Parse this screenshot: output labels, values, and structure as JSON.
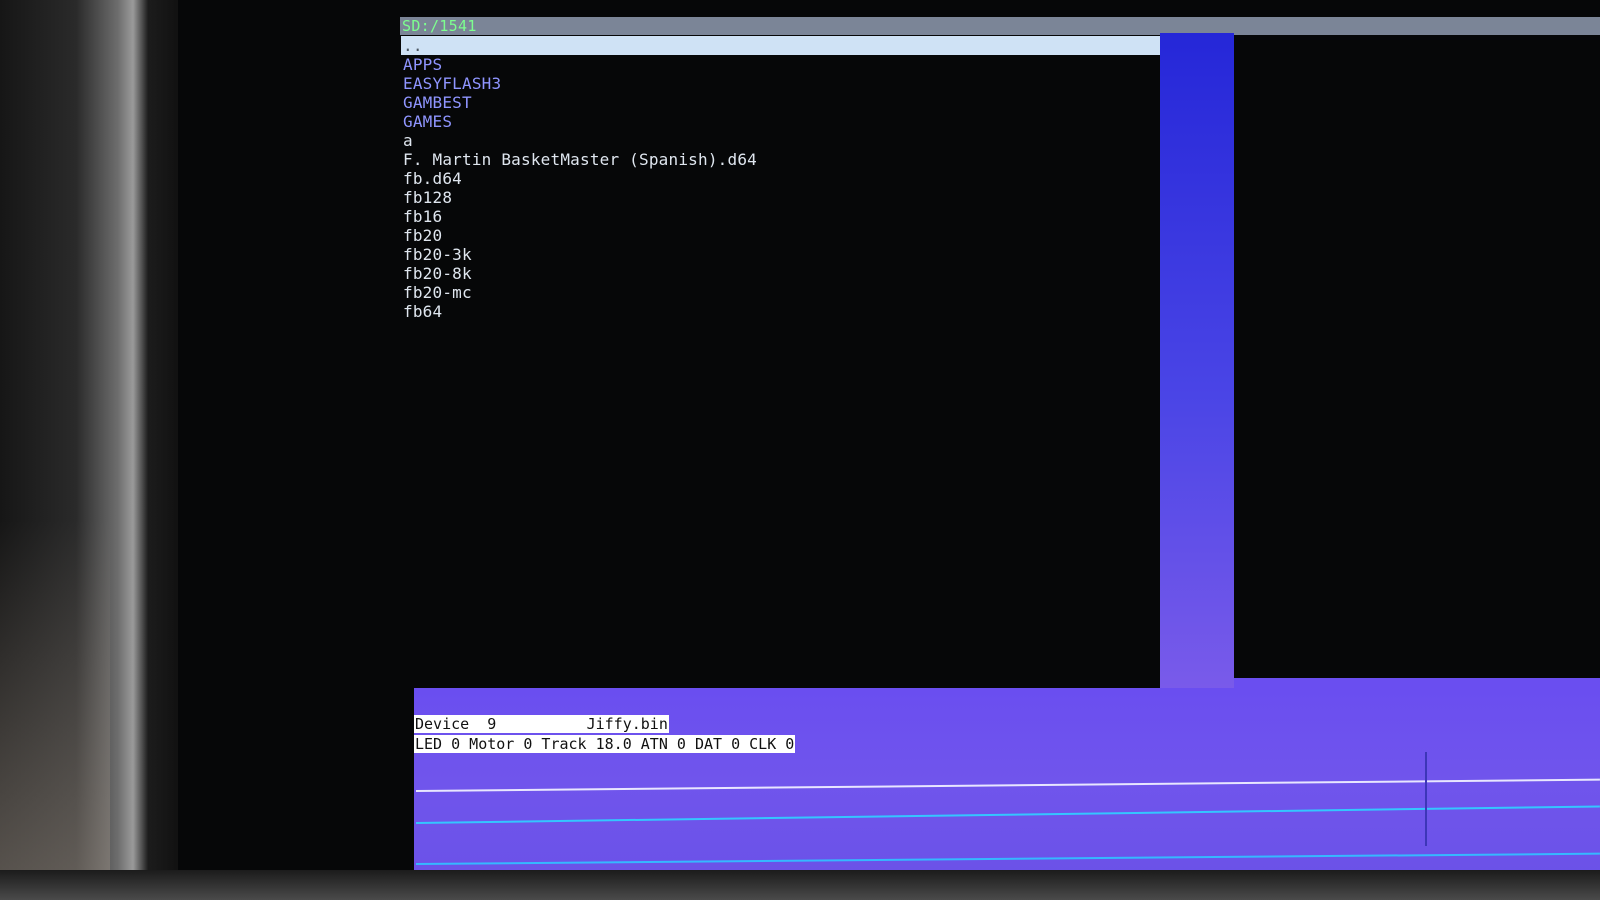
{
  "browser": {
    "path": "SD:/1541",
    "entries": [
      {
        "label": "..",
        "type": "parent",
        "selected": true
      },
      {
        "label": "APPS",
        "type": "dir"
      },
      {
        "label": "EASYFLASH3",
        "type": "dir"
      },
      {
        "label": "GAMBEST",
        "type": "dir"
      },
      {
        "label": "GAMES",
        "type": "dir"
      },
      {
        "label": "a",
        "type": "file"
      },
      {
        "label": "F. Martin BasketMaster (Spanish).d64",
        "type": "file"
      },
      {
        "label": "fb.d64",
        "type": "file"
      },
      {
        "label": "fb128",
        "type": "file"
      },
      {
        "label": "fb16",
        "type": "file"
      },
      {
        "label": "fb20",
        "type": "file"
      },
      {
        "label": "fb20-3k",
        "type": "file"
      },
      {
        "label": "fb20-8k",
        "type": "file"
      },
      {
        "label": "fb20-mc",
        "type": "file"
      },
      {
        "label": "fb64",
        "type": "file"
      }
    ]
  },
  "status": {
    "device_line": "Device  9          Jiffy.bin",
    "drive_line": "LED 0 Motor 0 Track 18.0 ATN 0 DAT 0 CLK 0"
  },
  "colors": {
    "path_text": "#7dff8f",
    "directory": "#8f95ff",
    "file": "#dfe6ef",
    "selection": "#cfe2f5",
    "raster_purple": "#6a4ef0"
  }
}
